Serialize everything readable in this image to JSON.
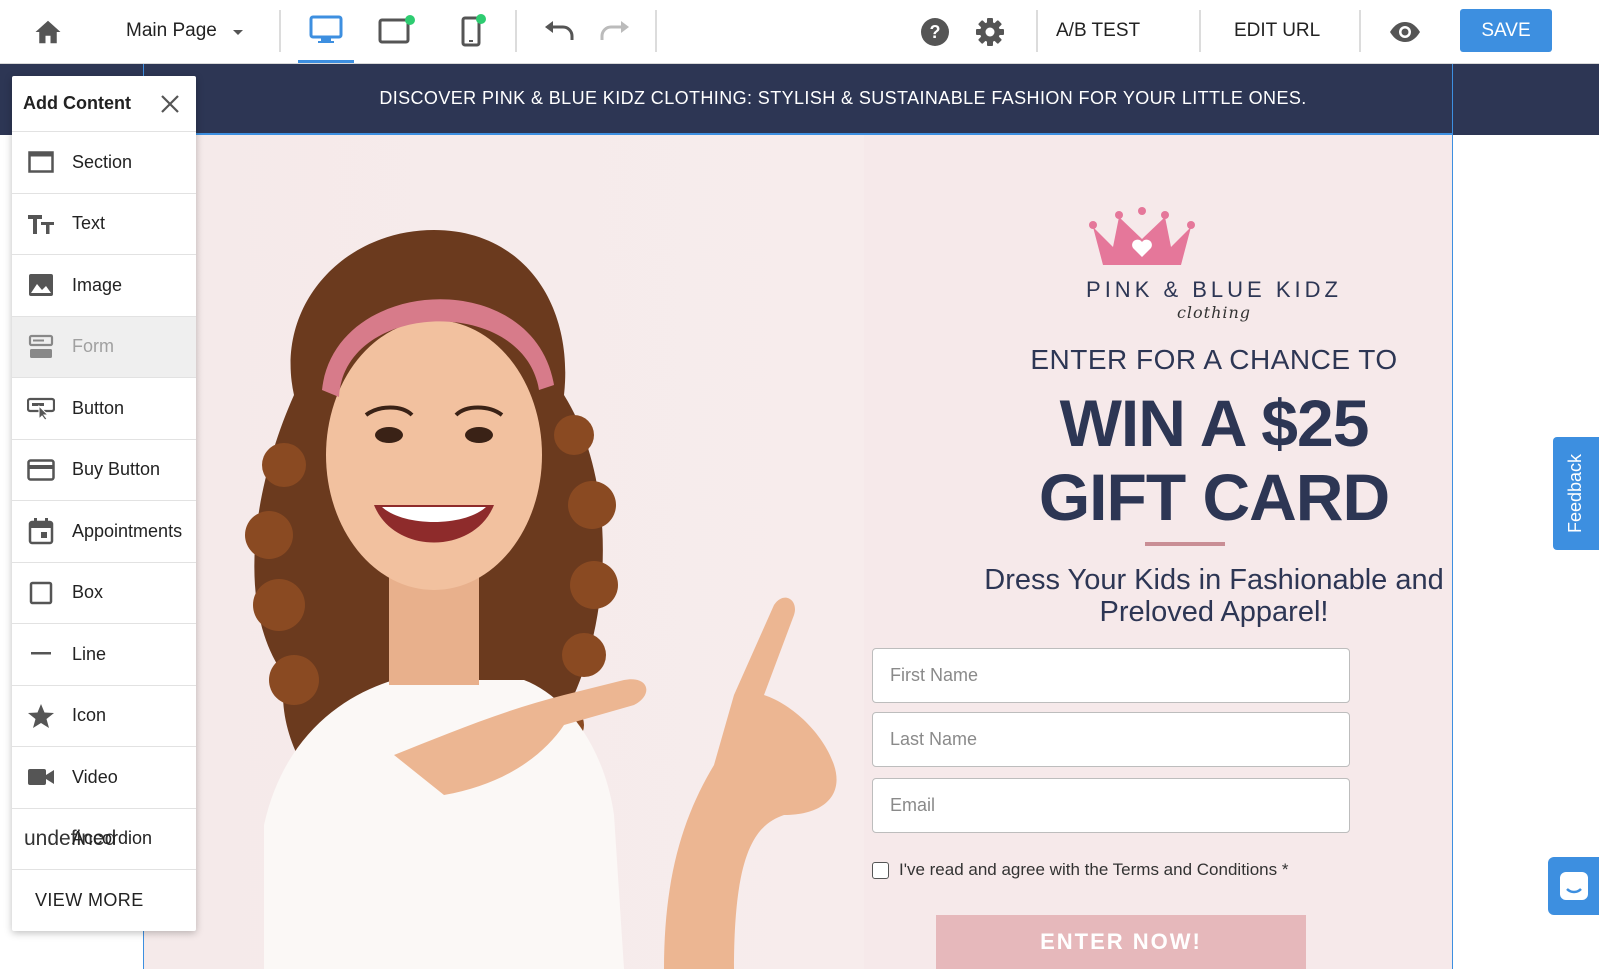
{
  "toolbar": {
    "page_selector": "Main Page",
    "ab_test": "A/B TEST",
    "edit_url": "EDIT URL",
    "save": "SAVE",
    "icons": [
      "home-icon",
      "desktop-icon",
      "tablet-icon",
      "mobile-icon",
      "undo-icon",
      "redo-icon",
      "help-icon",
      "gear-icon",
      "eye-icon"
    ],
    "accent_color": "#3d8fe0"
  },
  "panel": {
    "title": "Add Content",
    "items": [
      {
        "label": "Section",
        "icon": "section-icon"
      },
      {
        "label": "Text",
        "icon": "text-icon"
      },
      {
        "label": "Image",
        "icon": "image-icon"
      },
      {
        "label": "Form",
        "icon": "form-icon",
        "disabled": true
      },
      {
        "label": "Button",
        "icon": "button-icon"
      },
      {
        "label": "Buy Button",
        "icon": "buy-button-icon"
      },
      {
        "label": "Appointments",
        "icon": "calendar-icon"
      },
      {
        "label": "Box",
        "icon": "box-icon"
      },
      {
        "label": "Line",
        "icon": "line-icon"
      },
      {
        "label": "Icon",
        "icon": "star-icon"
      },
      {
        "label": "Video",
        "icon": "video-icon"
      },
      {
        "label": "Accordion",
        "icon_text": "undefined"
      }
    ],
    "view_more": "VIEW MORE"
  },
  "page": {
    "banner": "DISCOVER PINK & BLUE KIDZ CLOTHING: STYLISH & SUSTAINABLE FASHION FOR YOUR LITTLE ONES.",
    "brand_name": "PINK & BLUE KIDZ",
    "brand_script": "clothing",
    "enter_line": "ENTER FOR A CHANCE TO",
    "win_line_1": "WIN A $25",
    "win_line_2": "GIFT CARD",
    "subhead": "Dress Your Kids in Fashionable and Preloved Apparel!",
    "form": {
      "first_name_placeholder": "First Name",
      "last_name_placeholder": "Last Name",
      "email_placeholder": "Email",
      "terms": "I've read and agree with the Terms and Conditions *",
      "submit": "ENTER NOW!"
    },
    "colors": {
      "navy": "#2d3654",
      "pink_bg": "#f6e9ea",
      "crown_pink": "#e5779a",
      "button_pink": "#e6b8bb"
    }
  },
  "feedback": "Feedback"
}
